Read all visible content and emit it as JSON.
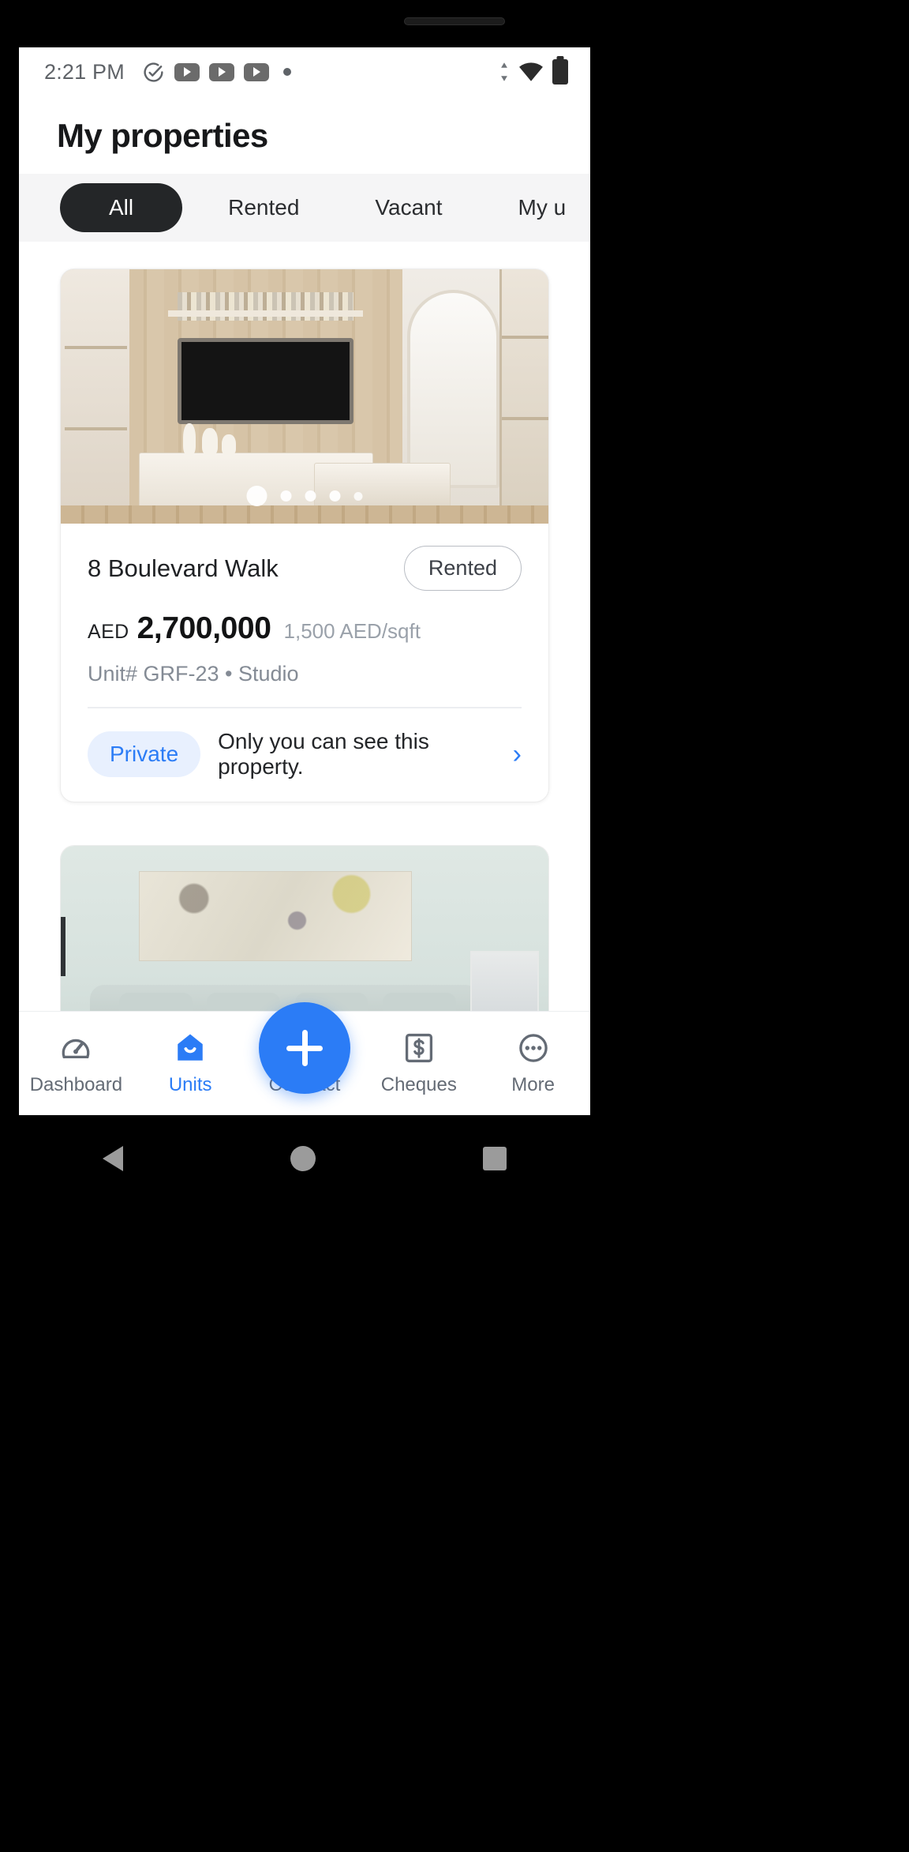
{
  "statusbar": {
    "time": "2:21 PM",
    "left_icons": [
      "check-circle-icon",
      "youtube-icon",
      "youtube-icon",
      "youtube-icon",
      "dot-icon"
    ],
    "right_icons": [
      "data-transfer-icon",
      "wifi-icon",
      "battery-icon"
    ]
  },
  "header": {
    "title": "My properties"
  },
  "tabs": [
    {
      "label": "All",
      "active": true
    },
    {
      "label": "Rented",
      "active": false
    },
    {
      "label": "Vacant",
      "active": false
    },
    {
      "label": "My u",
      "active": false
    }
  ],
  "cards": [
    {
      "title": "8 Boulevard Walk",
      "status_badge": "Rented",
      "currency": "AED",
      "price": "2,700,000",
      "price_per_sqft": "1,500 AED/sqft",
      "unit_line": "Unit# GRF-23 • Studio",
      "visibility_badge": "Private",
      "visibility_text": "Only you can see this property.",
      "chevron": "›",
      "photo_dots": 5,
      "photo_active_dot": 1
    }
  ],
  "fab": {
    "icon": "plus-icon"
  },
  "bottomnav": [
    {
      "label": "Dashboard",
      "icon": "dashboard-gauge-icon",
      "active": false
    },
    {
      "label": "Units",
      "icon": "home-units-icon",
      "active": true
    },
    {
      "label": "Contract",
      "icon": "signature-icon",
      "active": false
    },
    {
      "label": "Cheques",
      "icon": "dollar-square-icon",
      "active": false
    },
    {
      "label": "More",
      "icon": "more-ellipsis-icon",
      "active": false
    }
  ],
  "sysnav": {
    "back": "back-triangle-icon",
    "home": "home-circle-icon",
    "recent": "recent-square-icon"
  },
  "colors": {
    "accent": "#2b7cf6",
    "active_tab_bg": "#242628",
    "chip_private_bg": "#e8f0fe",
    "muted": "#848b95"
  }
}
